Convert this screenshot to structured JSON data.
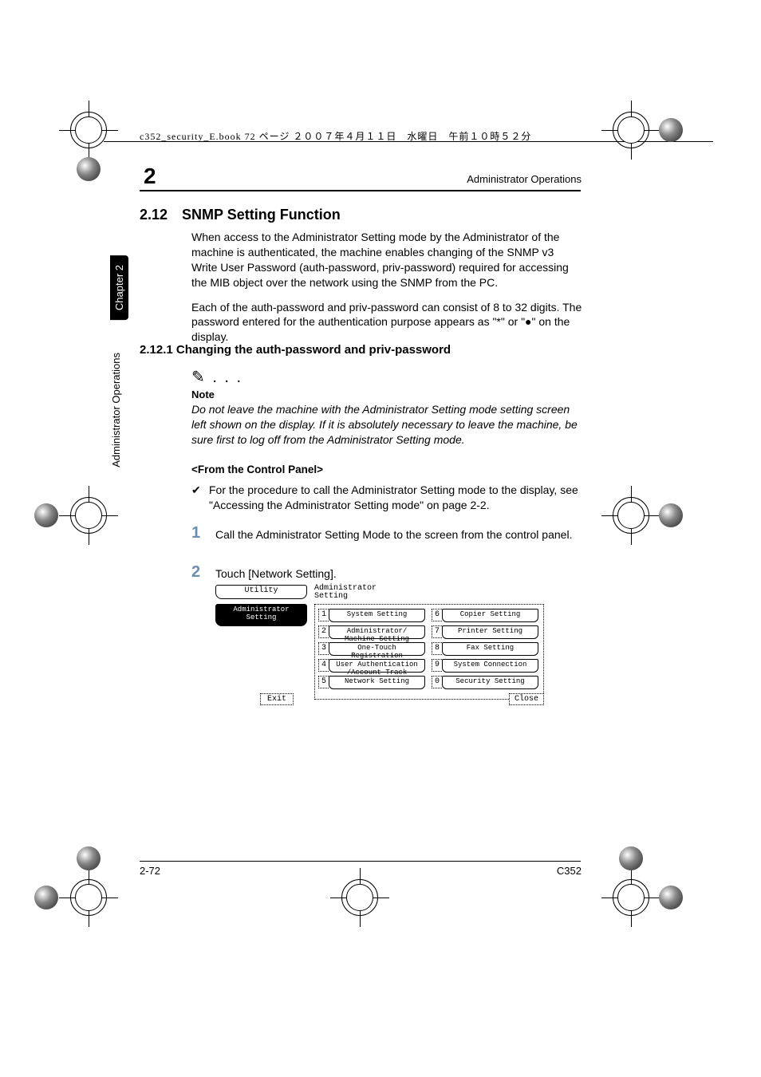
{
  "header": {
    "file_info": "c352_security_E.book  72 ページ  ２００７年４月１１日　水曜日　午前１０時５２分",
    "running_head": "Administrator Operations",
    "chapter_num": "2"
  },
  "side": {
    "chapter_tab": "Chapter 2",
    "operations_tab": "Administrator Operations"
  },
  "section": {
    "number": "2.12",
    "title": "SNMP Setting Function",
    "para1": "When access to the Administrator Setting mode by the Administrator of the machine is authenticated, the machine enables changing of the SNMP v3 Write User Password (auth-password, priv-password) required for accessing the MIB object over the network using the SNMP from the PC.",
    "para2": "Each of the auth-password and priv-password can consist of 8 to 32 digits. The password entered for the authentication purpose appears as \"*\" or \"●\" on the display."
  },
  "subsection": {
    "number": "2.12.1",
    "title": "Changing the auth-password and priv-password"
  },
  "note": {
    "icon": "✎ . . .",
    "label": "Note",
    "text": "Do not leave the machine with the Administrator Setting mode setting screen left shown on the display. If it is absolutely necessary to leave the machine, be sure first to log off from the Administrator Setting mode."
  },
  "from_panel": "<From the Control Panel>",
  "check": {
    "mark": "✔",
    "text": "For the procedure to call the Administrator Setting mode to the display, see \"Accessing the Administrator Setting mode\" on page 2-2."
  },
  "steps": {
    "s1": {
      "num": "1",
      "text": "Call the Administrator Setting Mode to the screen from the control panel."
    },
    "s2": {
      "num": "2",
      "text": "Touch [Network Setting]."
    }
  },
  "panel": {
    "left_tab1": "Utility",
    "left_tab2": "Administrator\nSetting",
    "exit": "Exit",
    "title": "Administrator\nSetting",
    "close": "Close",
    "items_left": [
      {
        "n": "1",
        "label": "System Setting"
      },
      {
        "n": "2",
        "label": "Administrator/\nMachine Setting"
      },
      {
        "n": "3",
        "label": "One-Touch\nRegistration"
      },
      {
        "n": "4",
        "label": "User Authentication\n/Account Track"
      },
      {
        "n": "5",
        "label": "Network Setting"
      }
    ],
    "items_right": [
      {
        "n": "6",
        "label": "Copier Setting"
      },
      {
        "n": "7",
        "label": "Printer Setting"
      },
      {
        "n": "8",
        "label": "Fax Setting"
      },
      {
        "n": "9",
        "label": "System Connection"
      },
      {
        "n": "0",
        "label": "Security Setting"
      }
    ]
  },
  "footer": {
    "page": "2-72",
    "model": "C352"
  }
}
